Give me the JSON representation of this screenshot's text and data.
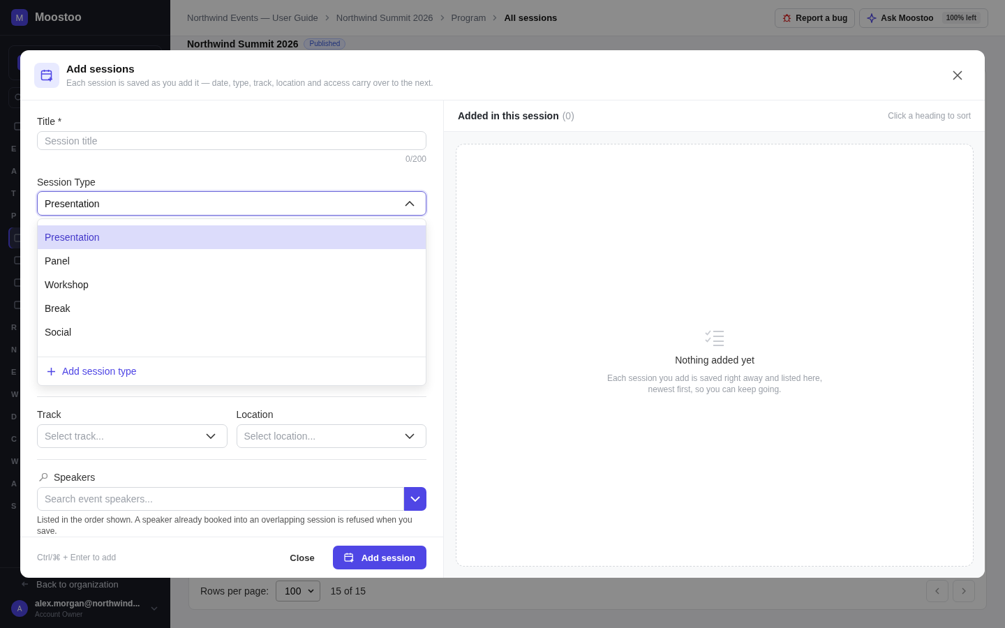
{
  "app": {
    "logo_letter": "M",
    "name": "Moostoo"
  },
  "breadcrumbs": [
    {
      "label": "Northwind Events — User Guide",
      "current": false
    },
    {
      "label": "Northwind Summit 2026",
      "current": false
    },
    {
      "label": "Program",
      "current": false
    },
    {
      "label": "All sessions",
      "current": true
    }
  ],
  "report_button": {
    "label": "Report a bug"
  },
  "ask_button": {
    "label": "Ask Moostoo",
    "quota": "100% left"
  },
  "page": {
    "title": "Northwind Summit 2026",
    "status": "Published"
  },
  "sidebar": {
    "nav": [
      {
        "kind": "icon",
        "selected": false
      },
      {
        "kind": "section",
        "label": "E",
        "selected": false
      },
      {
        "kind": "section",
        "label": "A",
        "selected": false
      },
      {
        "kind": "section",
        "label": "T",
        "selected": false
      },
      {
        "kind": "section",
        "label": "P",
        "selected": false
      },
      {
        "kind": "icon",
        "selected": true
      },
      {
        "kind": "icon",
        "selected": false
      },
      {
        "kind": "icon",
        "selected": false
      },
      {
        "kind": "icon",
        "selected": false
      },
      {
        "kind": "section",
        "label": "R",
        "selected": false
      },
      {
        "kind": "section",
        "label": "N",
        "selected": false
      },
      {
        "kind": "section",
        "label": "E",
        "selected": false
      },
      {
        "kind": "section",
        "label": "W",
        "selected": false
      },
      {
        "kind": "section",
        "label": "D",
        "selected": false
      },
      {
        "kind": "section",
        "label": "C",
        "selected": false
      },
      {
        "kind": "section",
        "label": "W",
        "selected": false
      },
      {
        "kind": "section",
        "label": "A",
        "selected": false
      },
      {
        "kind": "section",
        "label": "S",
        "selected": false
      }
    ],
    "back_link": "Back to organization",
    "user": {
      "avatar_letter": "A",
      "email": "alex.morgan@northwind...",
      "role": "Account Owner"
    }
  },
  "pagination": {
    "rows_label": "Rows per page:",
    "rows_value": "100",
    "range": "15 of 15"
  },
  "modal": {
    "title": "Add sessions",
    "subtitle": "Each session is saved as you add it — date, type, track, location and access carry over to the next.",
    "form": {
      "title_field": {
        "label": "Title *",
        "placeholder": "Session title",
        "counter": "0/200"
      },
      "session_type": {
        "label": "Session Type",
        "value": "Presentation",
        "expanded": true,
        "options": [
          {
            "label": "Presentation",
            "selected": true
          },
          {
            "label": "Panel",
            "selected": false
          },
          {
            "label": "Workshop",
            "selected": false
          },
          {
            "label": "Break",
            "selected": false
          },
          {
            "label": "Social",
            "selected": false
          }
        ],
        "add_option": "Add session type"
      },
      "track": {
        "label": "Track",
        "placeholder": "Select track..."
      },
      "location": {
        "label": "Location",
        "placeholder": "Select location..."
      },
      "speakers": {
        "label": "Speakers",
        "placeholder": "Search event speakers...",
        "help": "Listed in the order shown. A speaker already booked into an overlapping session is refused when you save."
      },
      "shortcut_hint": "Ctrl/⌘ + Enter to add",
      "close_button": "Close",
      "submit_button": "Add session"
    },
    "panel": {
      "title": "Added in this session",
      "count": "(0)",
      "sort_hint": "Click a heading to sort",
      "empty": {
        "title": "Nothing added yet",
        "text": "Each session you add is saved right away and listed here, newest first, so you can keep going."
      }
    }
  }
}
